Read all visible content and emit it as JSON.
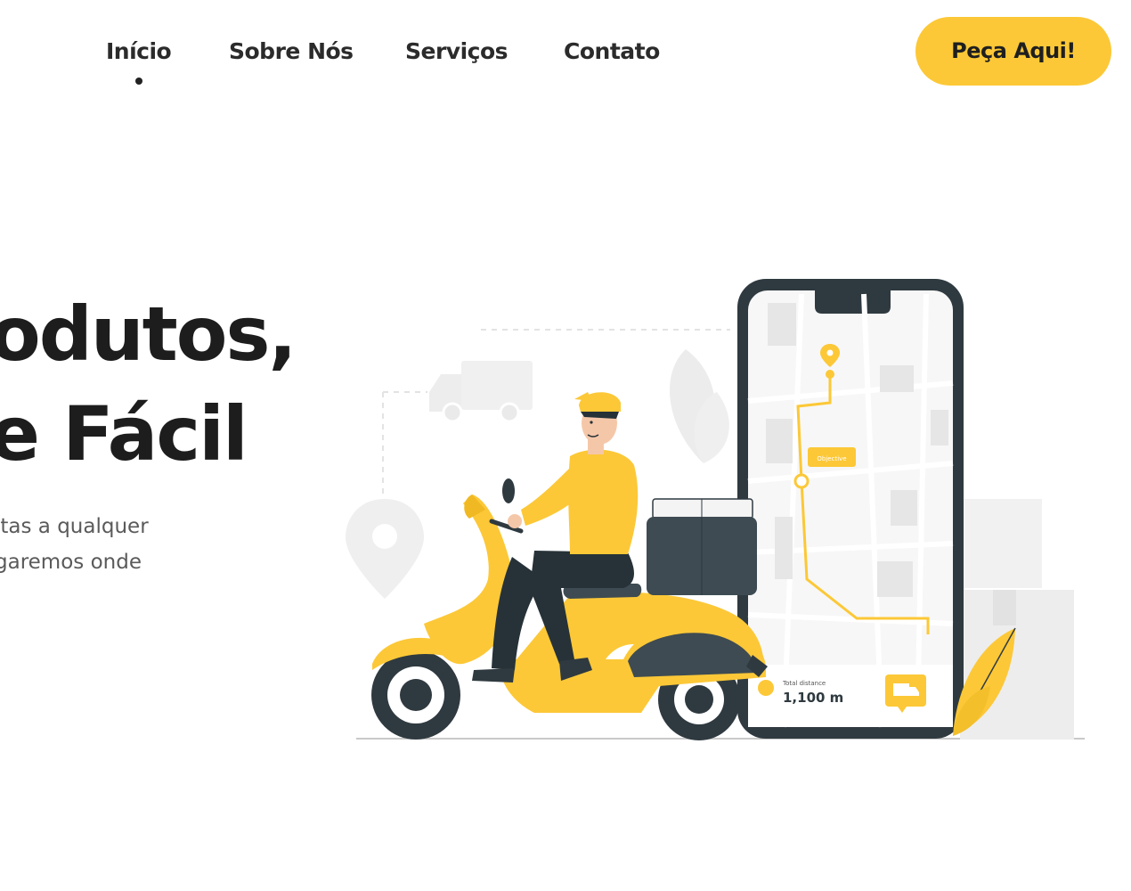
{
  "colors": {
    "accent": "#fcc837",
    "text_dark": "#1d1d1d",
    "text_muted": "#5a5a5a",
    "phone_frame": "#2f3a40"
  },
  "nav": {
    "items": [
      {
        "label": "Início",
        "active": true
      },
      {
        "label": "Sobre Nós",
        "active": false
      },
      {
        "label": "Serviços",
        "active": false
      },
      {
        "label": "Contato",
        "active": false
      }
    ],
    "cta_label": "Peça Aqui!"
  },
  "hero": {
    "title_line1": "odutos,",
    "title_line2": "e Fácil",
    "text_line1": "itas a qualquer",
    "text_line2": "garemos onde"
  },
  "illustration": {
    "map_label": "Objective",
    "distance_caption": "Total distance",
    "distance_value": "1,100 m",
    "icons": [
      "delivery-scooter-icon",
      "map-pin-icon",
      "truck-icon",
      "phone-icon",
      "leaf-icon"
    ]
  }
}
